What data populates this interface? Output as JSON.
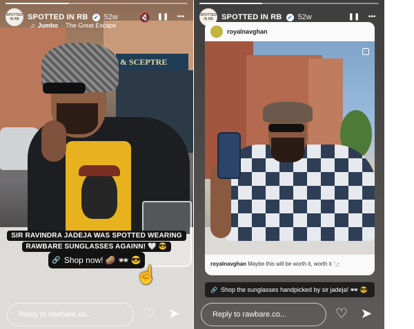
{
  "stories": {
    "left": {
      "account_name": "SPOTTED IN RB",
      "avatar_text": "SPOTTED IN RB",
      "age": "52w",
      "music": {
        "artist": "Jumbo",
        "song": "The Great Escape"
      },
      "sign_text": "& SCEPTRE",
      "caption_line1": "SIR RAVINDRA JADEJA WAS SPOTTED WEARING",
      "caption_line2": "RAWBARE SUNGLASSES AGAINN! 🤍 😎",
      "shop_label": "Shop now! 🥔 🕶 😎",
      "reply_placeholder": "Reply to rawbare.co...",
      "progress": 0.35
    },
    "right": {
      "account_name": "SPOTTED IN RB",
      "avatar_text": "SPOTTED IN RB",
      "age": "52w",
      "repost_user": "royalnavghan",
      "repost_caption_user": "royalnavghan",
      "repost_caption": "Maybe this will be worth it, worth it 🦙",
      "shop_label": "Shop the sunglasses handpicked by sir jadeja! 🕶 😎",
      "reply_placeholder": "Reply to rawbare.co...",
      "progress": 0.35
    }
  },
  "icons": {
    "verified": "✔",
    "mute": "🔇",
    "pause": "❚❚",
    "more": "•••",
    "music_note": "♫",
    "link": "🔗",
    "heart": "♡",
    "send": "➤",
    "pointer": "☝"
  },
  "colors": {
    "pill_bg": "#141414",
    "verified_blue": "#3a7bd5"
  }
}
